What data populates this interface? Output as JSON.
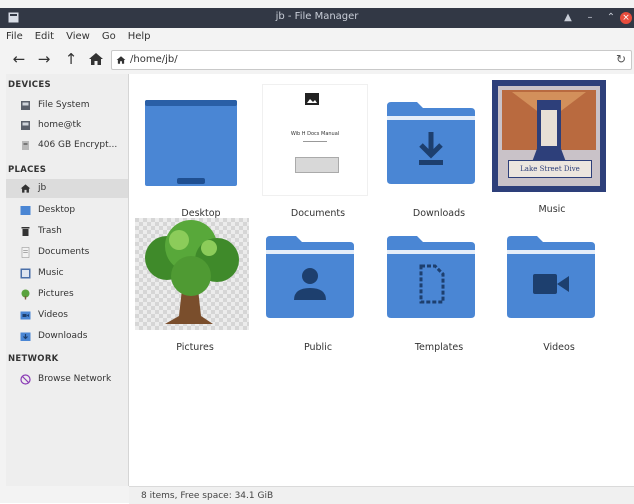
{
  "window": {
    "title": "jb - File Manager"
  },
  "menu": [
    "File",
    "Edit",
    "View",
    "Go",
    "Help"
  ],
  "location": {
    "path": "/home/jb/"
  },
  "sidebar": {
    "devices_header": "DEVICES",
    "devices": [
      "File System",
      "home@tk",
      "406 GB Encrypt..."
    ],
    "places_header": "PLACES",
    "places": [
      "jb",
      "Desktop",
      "Trash",
      "Documents",
      "Music",
      "Pictures",
      "Videos",
      "Downloads"
    ],
    "network_header": "NETWORK",
    "network": [
      "Browse Network"
    ]
  },
  "files": [
    "Desktop",
    "Documents",
    "Downloads",
    "Music",
    "Pictures",
    "Public",
    "Templates",
    "Videos"
  ],
  "thumbnails": {
    "documents": {
      "title": "Wib H Docs Manual"
    },
    "music": {
      "banner": "Lake Street Dive"
    }
  },
  "status": "8 items, Free space: 34.1 GiB",
  "colors": {
    "folder_blue": "#4a86d4",
    "folder_dark": "#2a5fa6",
    "titlebar": "#323845"
  },
  "icons": {
    "folders": [
      "desktop-folder-icon",
      "downloads-folder-icon",
      "public-folder-icon",
      "templates-folder-icon",
      "videos-folder-icon"
    ]
  }
}
